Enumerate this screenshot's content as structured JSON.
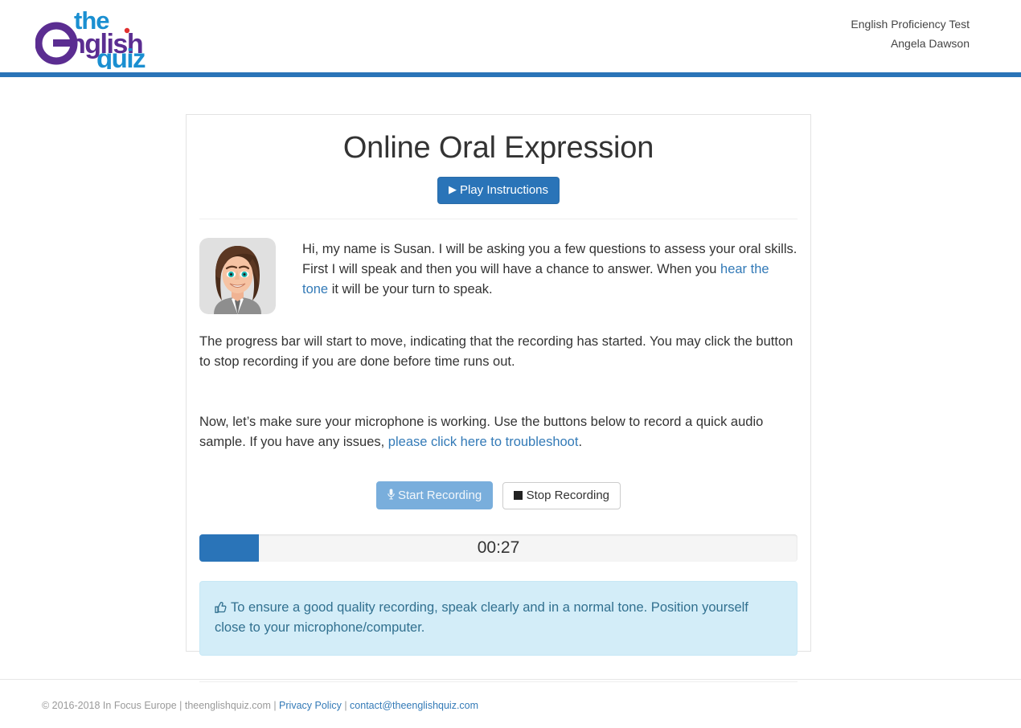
{
  "header": {
    "logo": {
      "line1": "the",
      "line2": "english",
      "line3": "quiz",
      "color_blue": "#1a8fd1",
      "color_purple": "#5b2d91"
    },
    "test_name": "English Proficiency Test",
    "user_name": "Angela Dawson",
    "rule_color": "#2a74b8"
  },
  "card": {
    "title": "Online Oral Expression",
    "play_button": {
      "label": "Play Instructions",
      "icon": "play-icon"
    },
    "intro": {
      "avatar_alt": "Susan avatar",
      "text_before_link": "Hi, my name is Susan. I will be asking you a few questions to assess your oral skills. First I will speak and then you will have a chance to answer. When you ",
      "link_text": "hear the tone",
      "text_after_link": " it will be your turn to speak."
    },
    "paragraph_progress": "The progress bar will start to move, indicating that the recording has started. You may click the button to stop recording if you are done before time runs out.",
    "paragraph_mic_before_link": "Now, let’s make sure your microphone is working. Use the buttons below to record a quick audio sample. If you have any issues, ",
    "paragraph_mic_link": "please click here to troubleshoot",
    "paragraph_mic_after_link": ".",
    "buttons": {
      "start_label": "Start Recording",
      "start_icon": "microphone-icon",
      "stop_label": "Stop Recording",
      "stop_icon": "stop-square-icon"
    },
    "progress": {
      "time_label": "00:27",
      "percent": 10,
      "fill_color": "#2a74b8"
    },
    "alert": {
      "icon": "thumbs-up-icon",
      "text": "To ensure a good quality recording, speak clearly and in a normal tone. Position yourself close to your microphone/computer.",
      "bg_color": "#d3edf8",
      "text_color": "#31708f"
    }
  },
  "footer": {
    "copyright": "© 2016-2018 In Focus Europe | theenglishquiz.com | ",
    "privacy_link": "Privacy Policy",
    "separator": " | ",
    "contact_link": "contact@theenglishquiz.com"
  }
}
